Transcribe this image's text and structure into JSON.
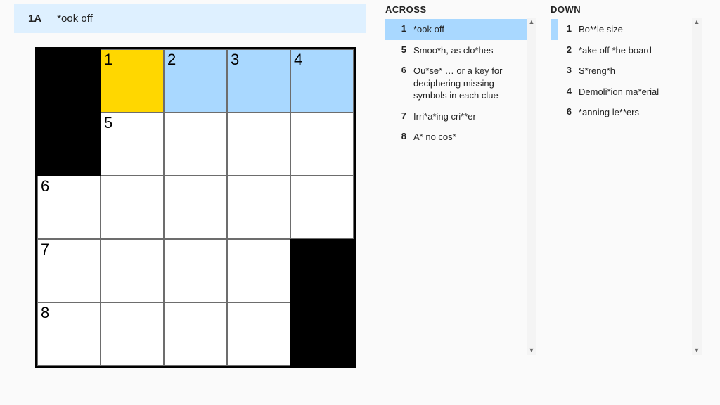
{
  "current_clue": {
    "label": "1A",
    "text": "*ook off"
  },
  "grid": {
    "rows": 5,
    "cols": 5,
    "cells": [
      [
        {
          "black": true
        },
        {
          "num": "1",
          "state": "focus"
        },
        {
          "num": "2",
          "state": "hi"
        },
        {
          "num": "3",
          "state": "hi"
        },
        {
          "num": "4",
          "state": "hi"
        }
      ],
      [
        {
          "black": true
        },
        {
          "num": "5"
        },
        {},
        {},
        {}
      ],
      [
        {
          "num": "6"
        },
        {},
        {},
        {},
        {}
      ],
      [
        {
          "num": "7"
        },
        {},
        {},
        {},
        {
          "black": true
        }
      ],
      [
        {
          "num": "8"
        },
        {},
        {},
        {},
        {
          "black": true
        }
      ]
    ]
  },
  "lists": {
    "across": {
      "title": "ACROSS",
      "items": [
        {
          "num": "1",
          "text": "*ook off",
          "sel": "full"
        },
        {
          "num": "5",
          "text": "Smoo*h, as clo*hes"
        },
        {
          "num": "6",
          "text": "Ou*se* … or a key for deciphering missing symbols in each clue"
        },
        {
          "num": "7",
          "text": "Irri*a*ing cri**er"
        },
        {
          "num": "8",
          "text": "A* no cos*"
        }
      ]
    },
    "down": {
      "title": "DOWN",
      "items": [
        {
          "num": "1",
          "text": "Bo**le size",
          "sel": "side"
        },
        {
          "num": "2",
          "text": "*ake off *he board"
        },
        {
          "num": "3",
          "text": "S*reng*h"
        },
        {
          "num": "4",
          "text": "Demoli*ion ma*erial"
        },
        {
          "num": "6",
          "text": "*anning le**ers"
        }
      ]
    }
  }
}
